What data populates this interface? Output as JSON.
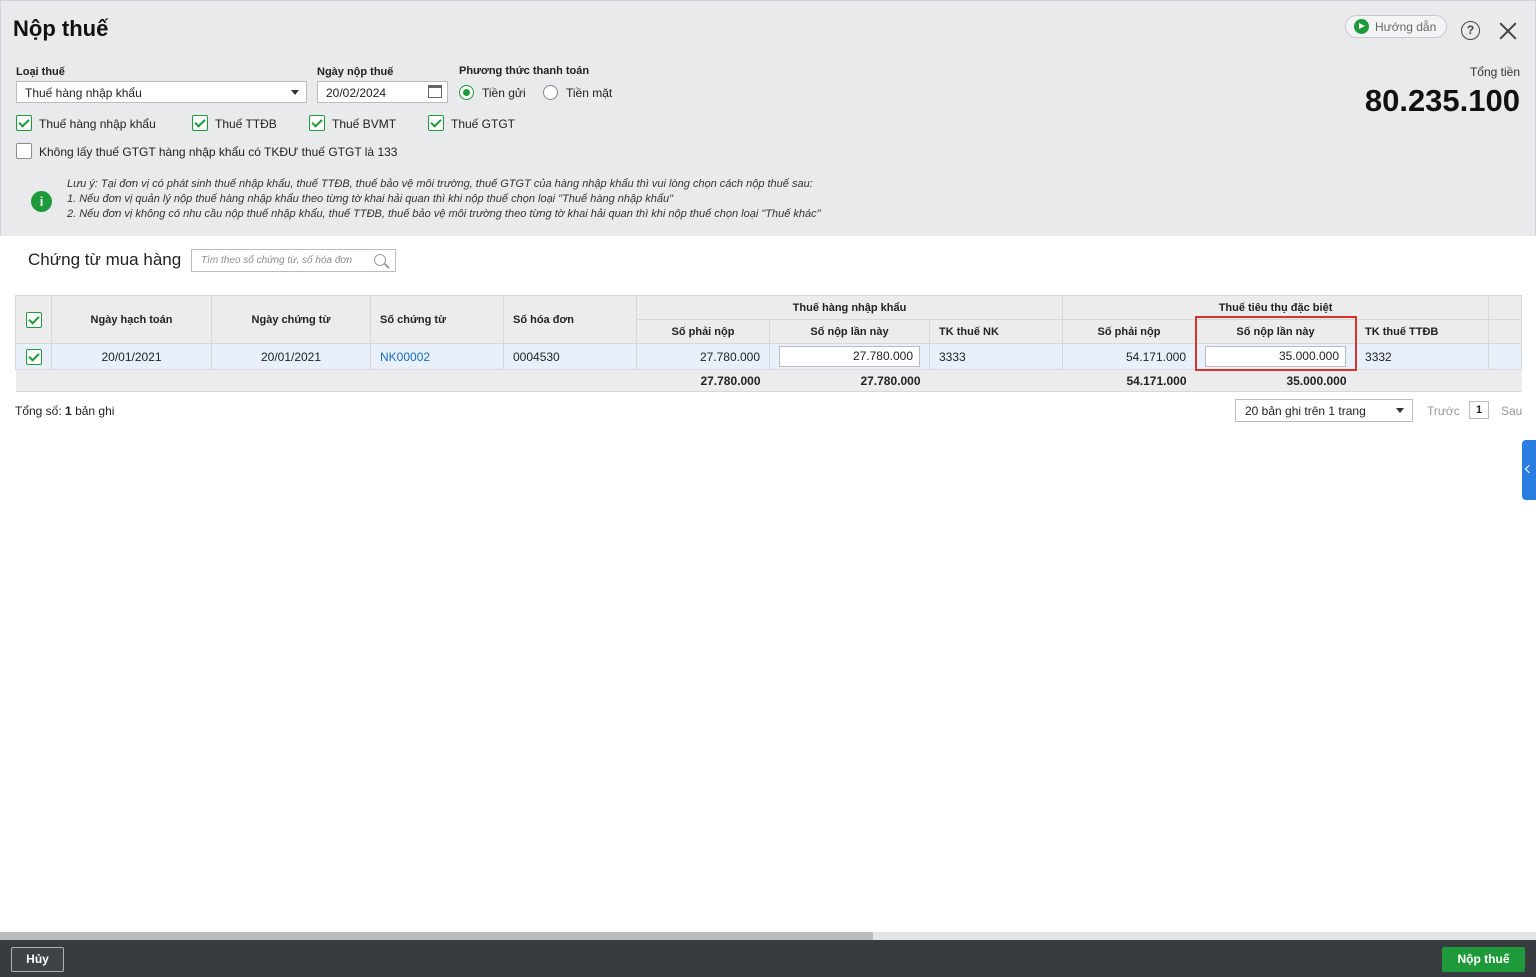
{
  "window": {
    "title": "Nộp thuế",
    "guide_label": "Hướng dẫn",
    "help_symbol": "?"
  },
  "form": {
    "tax_type_label": "Loại thuế",
    "tax_type_value": "Thuế hàng nhập khẩu",
    "pay_date_label": "Ngày nộp thuế",
    "pay_date_value": "20/02/2024",
    "payment_method_label": "Phương thức thanh toán",
    "payment_options": [
      {
        "label": "Tiền gửi",
        "selected": true
      },
      {
        "label": "Tiền mặt",
        "selected": false
      }
    ],
    "tax_checkboxes": [
      {
        "label": "Thuế hàng nhập khẩu",
        "checked": true
      },
      {
        "label": "Thuế TTĐB",
        "checked": true
      },
      {
        "label": "Thuế BVMT",
        "checked": true
      },
      {
        "label": "Thuế GTGT",
        "checked": true
      }
    ],
    "exclude_checkbox": {
      "label": "Không lấy thuế GTGT hàng nhập khẩu có TKĐƯ thuế GTGT là 133",
      "checked": false
    }
  },
  "note": {
    "lines": [
      "Lưu ý: Tại đơn vị có phát sinh thuế nhập khẩu, thuế TTĐB, thuế bảo vệ môi trường, thuế GTGT của hàng nhập khẩu thì vui lòng chọn cách nộp thuế sau:",
      "1. Nếu đơn vị quản lý nộp thuế hàng nhập khẩu theo từng tờ khai hải quan thì khi nộp thuế chọn loại \"Thuế hàng nhập khẩu\"",
      "2. Nếu đơn vị không có nhu cầu nộp thuế nhập khẩu, thuế TTĐB, thuế bảo vệ môi trường theo từng tờ khai hải quan thì khi nộp thuế chọn loại \"Thuế khác\""
    ]
  },
  "total": {
    "label": "Tổng tiền",
    "value": "80.235.100"
  },
  "section": {
    "title": "Chứng từ mua hàng",
    "search_placeholder": "Tìm theo số chứng từ, số hóa đơn"
  },
  "table": {
    "headers": {
      "posting_date": "Ngày hạch toán",
      "doc_date": "Ngày chứng từ",
      "doc_no": "Số chứng từ",
      "invoice_no": "Số hóa đơn",
      "import_group": "Thuế hàng nhập khẩu",
      "excise_group": "Thuế tiêu thụ đặc biệt",
      "payable": "Số phải nộp",
      "pay_now": "Số nộp lần này",
      "import_acc": "TK thuế NK",
      "excise_payable": "Số phải nộp",
      "excise_pay_now": "Số nộp lần này",
      "excise_acc": "TK thuế TTĐB"
    },
    "rows": [
      {
        "checked": true,
        "posting_date": "20/01/2021",
        "doc_date": "20/01/2021",
        "doc_no": "NK00002",
        "invoice_no": "0004530",
        "import_payable": "27.780.000",
        "import_pay_now": "27.780.000",
        "import_acc": "3333",
        "excise_payable": "54.171.000",
        "excise_pay_now": "35.000.000",
        "excise_acc": "3332"
      }
    ],
    "totals": {
      "import_payable": "27.780.000",
      "import_pay_now": "27.780.000",
      "excise_payable": "54.171.000",
      "excise_pay_now": "35.000.000"
    }
  },
  "footer": {
    "total_prefix": "Tổng số:",
    "total_count": "1",
    "total_suffix": "bản ghi",
    "page_size_value": "20 bản ghi trên 1 trang",
    "prev_label": "Trước",
    "page_number": "1",
    "next_label": "Sau"
  },
  "actions": {
    "cancel_label": "Hủy",
    "submit_label": "Nộp thuế"
  },
  "colors": {
    "accent_green": "#1e9a3a",
    "highlight_red": "#d9342b",
    "link_blue": "#1b6bc0"
  }
}
